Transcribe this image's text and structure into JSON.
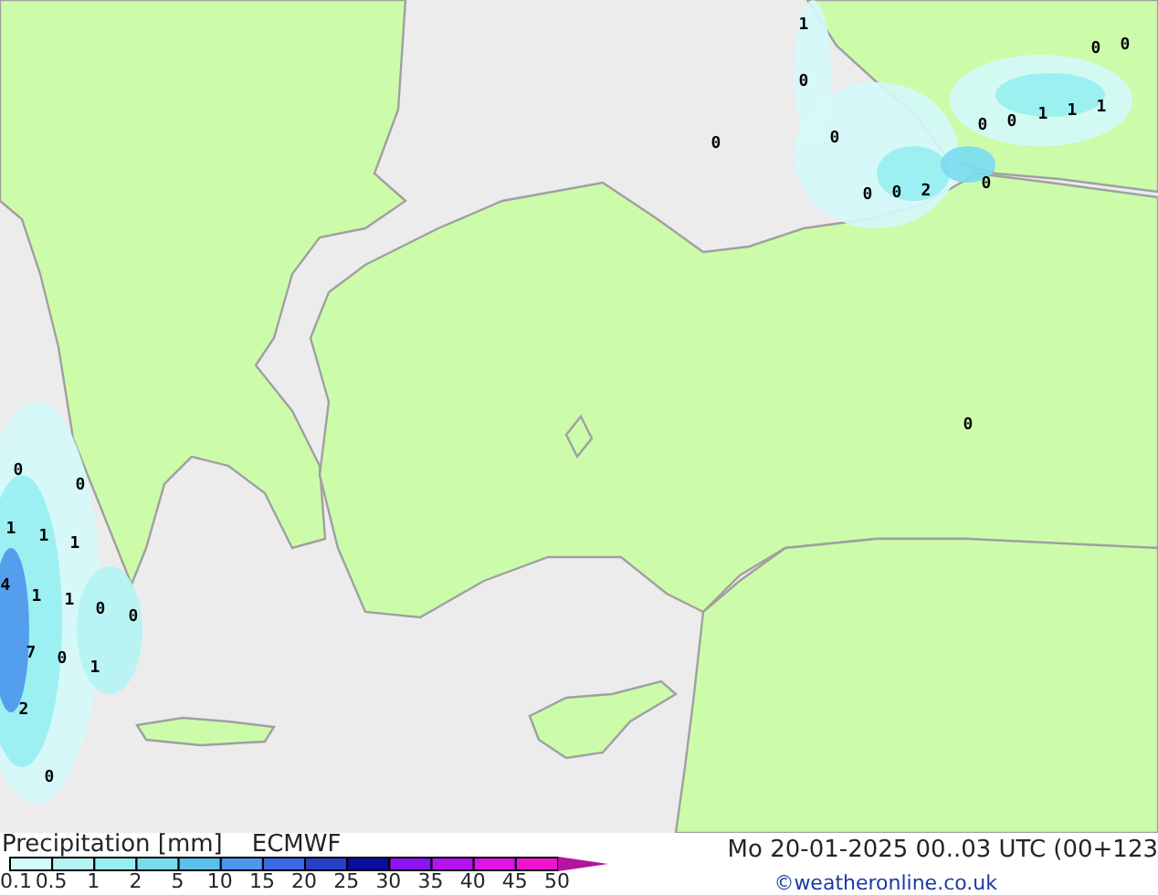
{
  "map": {
    "labels": [
      "1",
      "0",
      "0",
      "0",
      "0",
      "0",
      "2",
      "0",
      "0",
      "0",
      "1",
      "1",
      "1",
      "0",
      "0",
      "0",
      "0",
      "0",
      "1",
      "1",
      "1",
      "4",
      "1",
      "1",
      "0",
      "0",
      "7",
      "0",
      "1",
      "2",
      "0"
    ]
  },
  "legend": {
    "title": "Precipitation [mm]",
    "model": "ECMWF",
    "bins": [
      {
        "tick": "0.1",
        "color": "#d4fafa"
      },
      {
        "tick": "0.5",
        "color": "#b4f4f4"
      },
      {
        "tick": "1",
        "color": "#96eef0"
      },
      {
        "tick": "2",
        "color": "#78dcef"
      },
      {
        "tick": "5",
        "color": "#5ac0ee"
      },
      {
        "tick": "10",
        "color": "#4c96ec"
      },
      {
        "tick": "15",
        "color": "#3c6ae4"
      },
      {
        "tick": "20",
        "color": "#2840c8"
      },
      {
        "tick": "25",
        "color": "#0c0ca0"
      },
      {
        "tick": "30",
        "color": "#8c14f0"
      },
      {
        "tick": "35",
        "color": "#b414f0"
      },
      {
        "tick": "40",
        "color": "#dc14e6"
      },
      {
        "tick": "45",
        "color": "#f014d2"
      },
      {
        "tick": "50",
        "color": "#b4149c"
      }
    ]
  },
  "footer": {
    "valid_time": "Mo 20-01-2025 00..03 UTC (00+123",
    "credit": "©weatheronline.co.uk"
  }
}
